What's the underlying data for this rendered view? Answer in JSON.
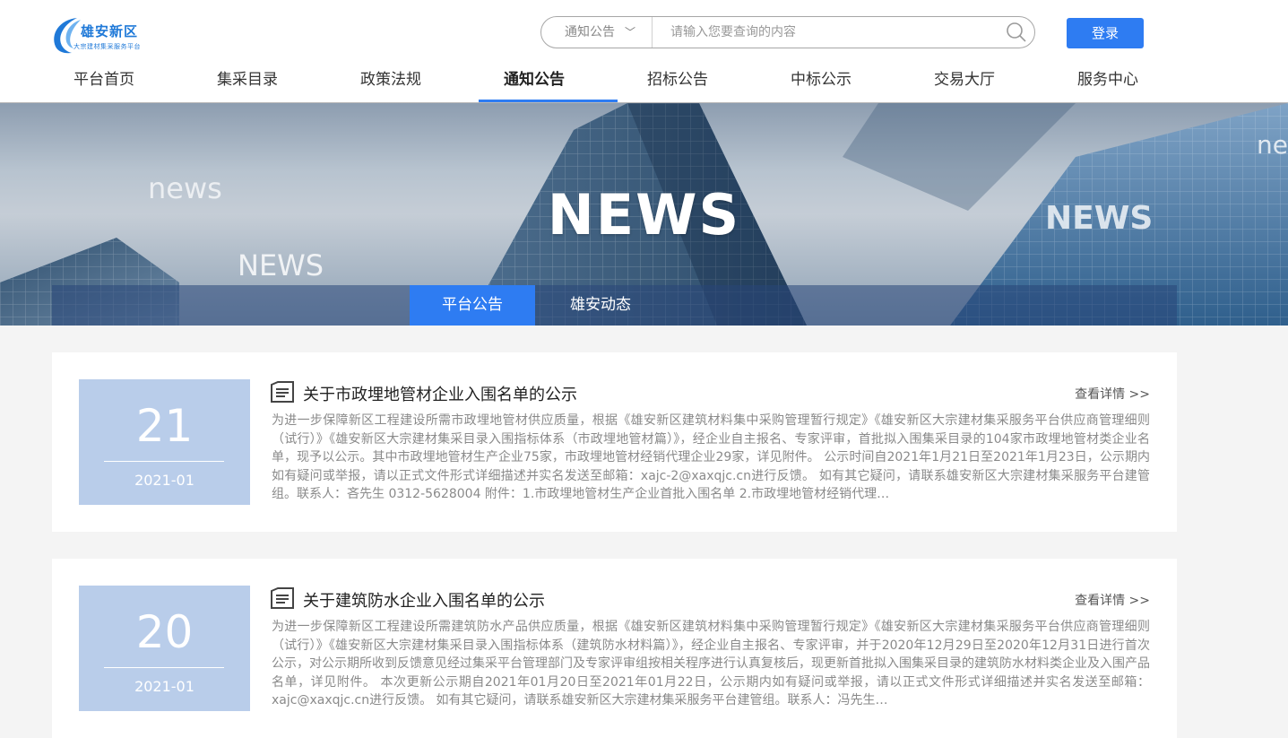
{
  "logo": {
    "title": "雄安新区",
    "subtitle": "大宗建材集采服务平台"
  },
  "search": {
    "category": "通知公告",
    "placeholder": "请输入您要查询的内容"
  },
  "header": {
    "login_label": "登录"
  },
  "nav": {
    "items": [
      {
        "label": "平台首页"
      },
      {
        "label": "集采目录"
      },
      {
        "label": "政策法规"
      },
      {
        "label": "通知公告",
        "active": true
      },
      {
        "label": "招标公告"
      },
      {
        "label": "中标公示"
      },
      {
        "label": "交易大厅"
      },
      {
        "label": "服务中心"
      }
    ]
  },
  "banner": {
    "title": "NEWS",
    "decor": [
      "news",
      "NEWS",
      "NEWS",
      "new"
    ]
  },
  "tabs": [
    {
      "label": "平台公告",
      "active": true
    },
    {
      "label": "雄安动态"
    }
  ],
  "news": [
    {
      "day": "21",
      "year_month": "2021-01",
      "title": "关于市政埋地管材企业入围名单的公示",
      "more": "查看详情 >>",
      "summary": "为进一步保障新区工程建设所需市政埋地管材供应质量，根据《雄安新区建筑材料集中采购管理暂行规定》《雄安新区大宗建材集采服务平台供应商管理细则（试行）》《雄安新区大宗建材集采目录入围指标体系（市政埋地管材篇）》，经企业自主报名、专家评审，首批拟入围集采目录的104家市政埋地管材类企业名单，现予以公示。其中市政埋地管材生产企业75家，市政埋地管材经销代理企业29家，详见附件。 公示时间自2021年1月21日至2021年1月23日，公示期内如有疑问或举报，请以正式文件形式详细描述并实名发送至邮箱：xajc-2@xaxqjc.cn进行反馈。 如有其它疑问，请联系雄安新区大宗建材集采服务平台建管组。联系人：吝先生 0312-5628004 附件：1.市政埋地管材生产企业首批入围名单 2.市政埋地管材经销代理…"
    },
    {
      "day": "20",
      "year_month": "2021-01",
      "title": "关于建筑防水企业入围名单的公示",
      "more": "查看详情 >>",
      "summary": "为进一步保障新区工程建设所需建筑防水产品供应质量，根据《雄安新区建筑材料集中采购管理暂行规定》《雄安新区大宗建材集采服务平台供应商管理细则（试行）》《雄安新区大宗建材集采目录入围指标体系（建筑防水材料篇）》，经企业自主报名、专家评审，并于2020年12月29日至2020年12月31日进行首次公示，对公示期所收到反馈意见经过集采平台管理部门及专家评审组按相关程序进行认真复核后，现更新首批拟入围集采目录的建筑防水材料类企业及入围产品名单，详见附件。 本次更新公示期自2021年01月20日至2021年01月22日，公示期内如有疑问或举报，请以正式文件形式详细描述并实名发送至邮箱：xajc@xaxqjc.cn进行反馈。 如有其它疑问，请联系雄安新区大宗建材集采服务平台建管组。联系人：冯先生…"
    }
  ],
  "colors": {
    "accent": "#2e7cf2",
    "date_box": "#b9cdea"
  }
}
